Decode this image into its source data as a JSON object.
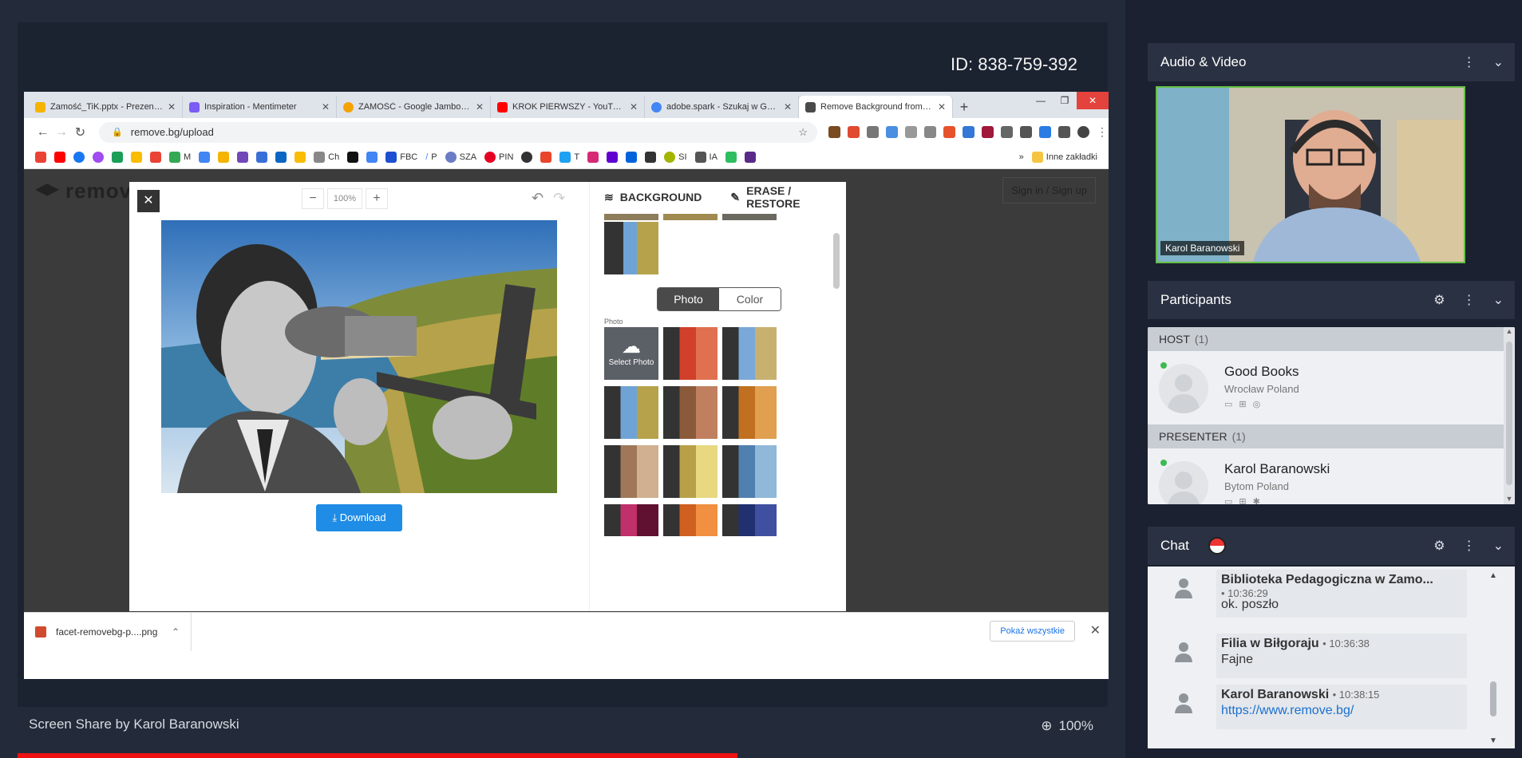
{
  "meeting": {
    "id": "ID: 838-759-392",
    "share_caption": "Screen Share by Karol Baranowski",
    "zoom": "100%",
    "video_progress": 0.66
  },
  "browser": {
    "tabs": [
      {
        "title": "Zamość_TiK.pptx - Prezentacje",
        "color": "#f5b400",
        "active": false
      },
      {
        "title": "Inspiration - Mentimeter",
        "color": "#7b5cf5",
        "active": false
      },
      {
        "title": "ZAMOŚĆ - Google Jamboard",
        "color": "#f5a300",
        "active": false
      },
      {
        "title": "KROK PIERWSZY - YouTube",
        "color": "#ff0000",
        "active": false
      },
      {
        "title": "adobe.spark - Szukaj w Google",
        "color": "#4285f4",
        "active": false
      },
      {
        "title": "Remove Background from Image",
        "color": "#4a4a4a",
        "active": true
      }
    ],
    "new_tab": "+",
    "url": "remove.bg/upload",
    "bookmarks": [
      "M",
      "Ch",
      "FBC",
      "P",
      "SZA",
      "PIN",
      "T",
      "SI",
      "IA"
    ],
    "bookmarks_more": "»",
    "other_bookmarks": "Inne zakładki"
  },
  "removebg": {
    "logo": "remove",
    "signin": "Sign in / Sign up",
    "zoom_minus": "−",
    "zoom_value": "100%",
    "zoom_plus": "+",
    "download": "Download",
    "tab_background": "BACKGROUND",
    "tab_erase": "ERASE / RESTORE",
    "toggle_photo": "Photo",
    "toggle_color": "Color",
    "photo_label": "Photo",
    "select_photo": "Select Photo"
  },
  "downloads": {
    "file": "facet-removebg-p....png",
    "show_all": "Pokaż wszystkie"
  },
  "sidebar": {
    "audio_video": {
      "title": "Audio & Video",
      "speaker": "Karol Baranowski"
    },
    "participants": {
      "title": "Participants",
      "groups": [
        {
          "label": "HOST",
          "count": "(1)",
          "name": "Good Books",
          "location": "Wrocław Poland"
        },
        {
          "label": "PRESENTER",
          "count": "(1)",
          "name": "Karol Baranowski",
          "location": "Bytom Poland"
        }
      ]
    },
    "chat": {
      "title": "Chat",
      "messages": [
        {
          "sender": "Biblioteka Pedagogiczna w Zamo...",
          "time": "10:36:29",
          "text": "ok. poszło"
        },
        {
          "sender": "Filia w Biłgoraju",
          "time": "10:36:38",
          "text": "Fajne"
        },
        {
          "sender": "Karol Baranowski",
          "time": "10:38:15",
          "text": "https://www.remove.bg/"
        }
      ]
    }
  }
}
